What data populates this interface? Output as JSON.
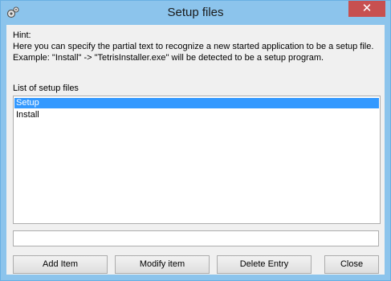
{
  "window": {
    "title": "Setup files",
    "close_label": "✕"
  },
  "hint": {
    "line1": "Hint:",
    "line2": "Here you can specify the partial text to recognize a new started application to be a setup file.",
    "line3": "Example: \"Install\" -> \"TetrisInstaller.exe\" will be detected to be a setup program."
  },
  "list": {
    "label": "List of setup files",
    "items": [
      {
        "label": "Setup",
        "selected": true
      },
      {
        "label": "Install",
        "selected": false
      }
    ]
  },
  "input": {
    "value": ""
  },
  "buttons": {
    "add": "Add Item",
    "modify": "Modify item",
    "delete": "Delete Entry",
    "close": "Close"
  },
  "icons": {
    "app": "gears-icon"
  },
  "colors": {
    "titlebar": "#8cc4ec",
    "close": "#c75050",
    "selection": "#3399ff"
  }
}
